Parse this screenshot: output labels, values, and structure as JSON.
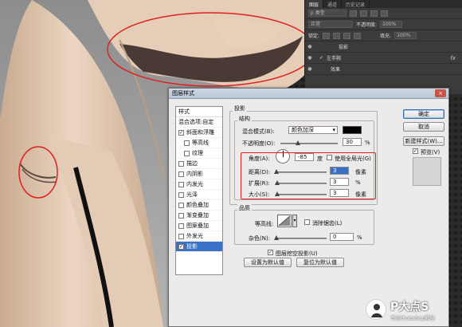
{
  "layers_panel": {
    "tabs": [
      "图层",
      "通道",
      "历史记录"
    ],
    "kind_label": "p 类型",
    "blend_mode": "正常",
    "opacity_label": "不透明度:",
    "opacity_value": "100%",
    "lock_label": "锁定:",
    "fill_label": "填充:",
    "fill_value": "100%",
    "rows": [
      {
        "name": "投影"
      },
      {
        "name": "左手腕"
      },
      {
        "name": "效果"
      }
    ],
    "fx_label": "fx"
  },
  "dialog": {
    "title": "图层样式",
    "close_label": "×",
    "styles_header": "样式",
    "styles": [
      {
        "label": "混合选项:自定",
        "checkbox": false,
        "checked": false,
        "active": false,
        "sub": false
      },
      {
        "label": "斜面和浮雕",
        "checkbox": true,
        "checked": true,
        "active": false,
        "sub": false
      },
      {
        "label": "等高线",
        "checkbox": true,
        "checked": false,
        "active": false,
        "sub": true
      },
      {
        "label": "纹理",
        "checkbox": true,
        "checked": false,
        "active": false,
        "sub": true
      },
      {
        "label": "描边",
        "checkbox": true,
        "checked": false,
        "active": false,
        "sub": false
      },
      {
        "label": "内阴影",
        "checkbox": true,
        "checked": false,
        "active": false,
        "sub": false
      },
      {
        "label": "内发光",
        "checkbox": true,
        "checked": false,
        "active": false,
        "sub": false
      },
      {
        "label": "光泽",
        "checkbox": true,
        "checked": false,
        "active": false,
        "sub": false
      },
      {
        "label": "颜色叠加",
        "checkbox": true,
        "checked": false,
        "active": false,
        "sub": false
      },
      {
        "label": "渐变叠加",
        "checkbox": true,
        "checked": false,
        "active": false,
        "sub": false
      },
      {
        "label": "图案叠加",
        "checkbox": true,
        "checked": false,
        "active": false,
        "sub": false
      },
      {
        "label": "外发光",
        "checkbox": true,
        "checked": false,
        "active": false,
        "sub": false
      },
      {
        "label": "投影",
        "checkbox": true,
        "checked": true,
        "active": true,
        "sub": false
      }
    ],
    "section_title": "投影",
    "structure_label": "结构",
    "blend_mode_label": "混合模式(B):",
    "blend_mode_value": "颜色加深",
    "opacity_label": "不透明度(O):",
    "opacity_value": "30",
    "percent": "%",
    "angle_label": "角度(A):",
    "angle_value": "-85",
    "degree": "度",
    "global_light_label": "使用全局光(G)",
    "distance_label": "距离(D):",
    "distance_value": "3",
    "spread_label": "扩展(R):",
    "spread_value": "3",
    "size_label": "大小(S):",
    "size_value": "3",
    "pixel_unit": "像素",
    "quality_label": "品质",
    "contour_label": "等高线:",
    "antialias_label": "消除锯齿(L)",
    "noise_label": "杂色(N):",
    "noise_value": "0",
    "knockout_label": "图层挖空投影(U)",
    "set_default_label": "设置为默认值",
    "reset_default_label": "复位为默认值",
    "ok_label": "确定",
    "cancel_label": "取消",
    "new_style_label": "新建样式(W)...",
    "preview_label": "预览(V)",
    "preview_checked": true,
    "shadow_color": "#000000"
  },
  "watermark": {
    "title": "P大点S",
    "subtitle": "专注Photoshop教程"
  },
  "colors": {
    "annotation_red": "#e02020",
    "selection_blue": "#3a71c6",
    "skin": "#d9bfa6",
    "panel_dark": "#3b3b3b"
  }
}
